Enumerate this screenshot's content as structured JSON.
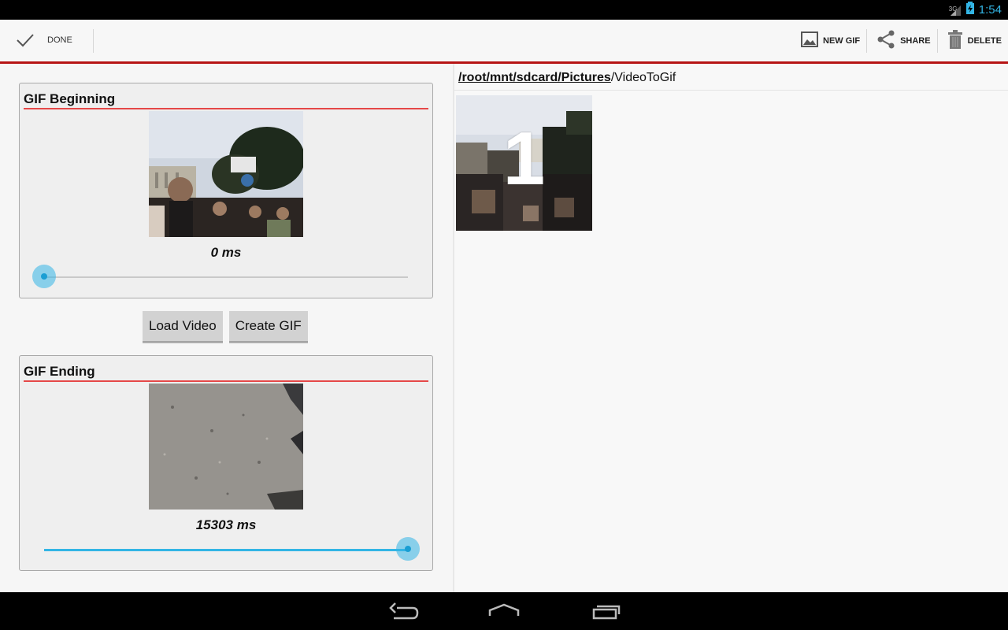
{
  "status_bar": {
    "network": "3G",
    "time": "1:54",
    "accent_color": "#33b5e5"
  },
  "action_bar": {
    "done_label": "DONE",
    "new_gif_label": "NEW GIF",
    "share_label": "SHARE",
    "delete_label": "DELETE",
    "underline_color": "#b71515"
  },
  "left_pane": {
    "beginning": {
      "title": "GIF Beginning",
      "time_label": "0 ms",
      "slider_position": 0
    },
    "buttons": {
      "load_video": "Load Video",
      "create_gif": "Create GIF"
    },
    "ending": {
      "title": "GIF Ending",
      "time_label": "15303 ms",
      "slider_position": 1
    }
  },
  "right_pane": {
    "path_link": "/root/mnt/sdcard/Pictures",
    "path_current": "/VideoToGif",
    "gif_items": [
      {
        "label": "1"
      }
    ]
  },
  "nav_bar": {
    "icons": [
      "back-icon",
      "home-icon",
      "recent-apps-icon"
    ]
  }
}
